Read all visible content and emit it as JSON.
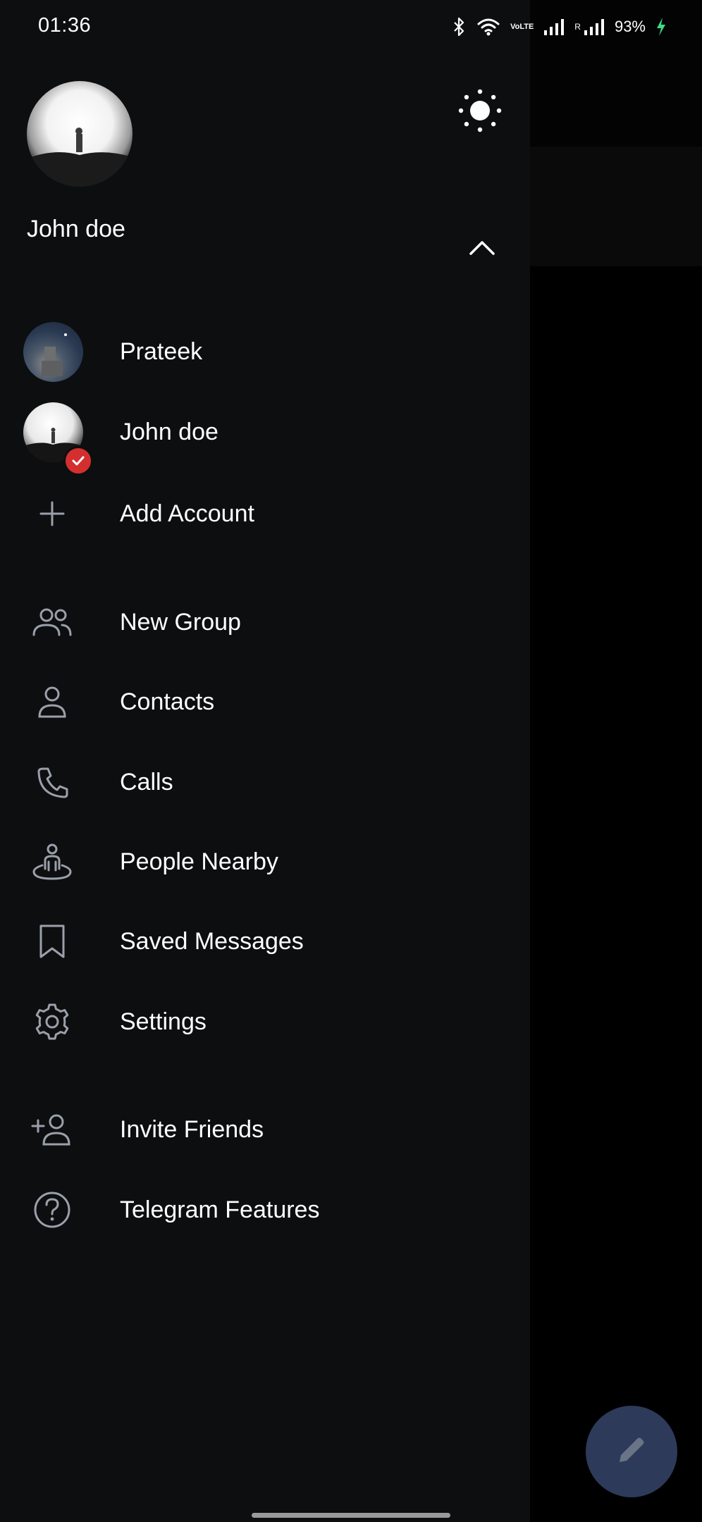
{
  "status_bar": {
    "time": "01:36",
    "network_label": "VoLTE",
    "roaming_label": "R",
    "battery_percent": "93%",
    "charging_color": "#3ddc84"
  },
  "drawer": {
    "header": {
      "user_name": "John doe"
    },
    "accounts": [
      {
        "name": "Prateek"
      },
      {
        "name": "John doe",
        "active": true
      }
    ],
    "add_account_label": "Add Account",
    "menu": [
      {
        "label": "New Group",
        "icon": "group-icon"
      },
      {
        "label": "Contacts",
        "icon": "person-icon"
      },
      {
        "label": "Calls",
        "icon": "phone-icon"
      },
      {
        "label": "People Nearby",
        "icon": "people-nearby-icon"
      },
      {
        "label": "Saved Messages",
        "icon": "bookmark-icon"
      },
      {
        "label": "Settings",
        "icon": "gear-icon"
      }
    ],
    "secondary_menu": [
      {
        "label": "Invite Friends",
        "icon": "add-person-icon"
      },
      {
        "label": "Telegram Features",
        "icon": "question-icon"
      }
    ]
  },
  "colors": {
    "drawer_bg": "#0d0e0f",
    "icon_color": "#9aa0ab",
    "badge_red": "#d32f2f",
    "fab_bg": "#2d3a5a"
  },
  "fab": {
    "icon": "pencil-icon"
  }
}
